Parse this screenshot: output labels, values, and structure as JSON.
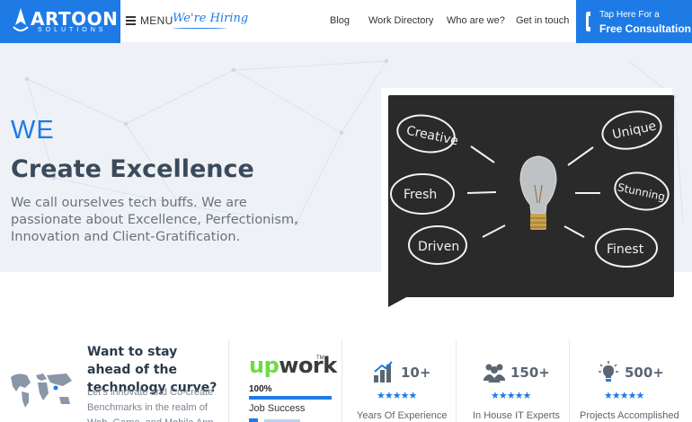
{
  "brand": {
    "name": "ARTOON",
    "tagline": "SOLUTIONS",
    "color": "#1e7be6"
  },
  "header": {
    "menu_label": "MENU",
    "hiring_label": "We're Hiring",
    "nav": [
      {
        "label": "Blog"
      },
      {
        "label": "Work Directory"
      },
      {
        "label": "Who are we?"
      },
      {
        "label": "Get in touch"
      }
    ],
    "cta": {
      "line1": "Tap Here For a",
      "line2": "Free Consultation",
      "icon": "phone-icon"
    }
  },
  "hero": {
    "we": "WE",
    "title": "Create Excellence",
    "description": "We call ourselves tech buffs. We are passionate about Excellence, Perfectionism, Innovation and Client-Gratification.",
    "board_words": [
      "Creative",
      "Unique",
      "Fresh",
      "Stunning",
      "Driven",
      "Finest"
    ]
  },
  "promo": {
    "title": "Want to stay ahead of the technology curve?",
    "description": "Let's innovate and Co-create Benchmarks in the realm of Web, Game, and Mobile App"
  },
  "upwork": {
    "logo_up": "up",
    "logo_work": "work",
    "tm": "TM",
    "percent": "100%",
    "percent_value": 100,
    "label": "Job Success"
  },
  "stats": [
    {
      "value": "10+",
      "label": "Years Of Experience",
      "icon": "chart-icon",
      "rating": "★★★★★"
    },
    {
      "value": "150+",
      "label": "In House IT Experts",
      "icon": "team-icon",
      "rating": "★★★★★"
    },
    {
      "value": "500+",
      "label": "Projects Accomplished",
      "icon": "lightbulb-icon",
      "rating": "★★★★★"
    }
  ]
}
